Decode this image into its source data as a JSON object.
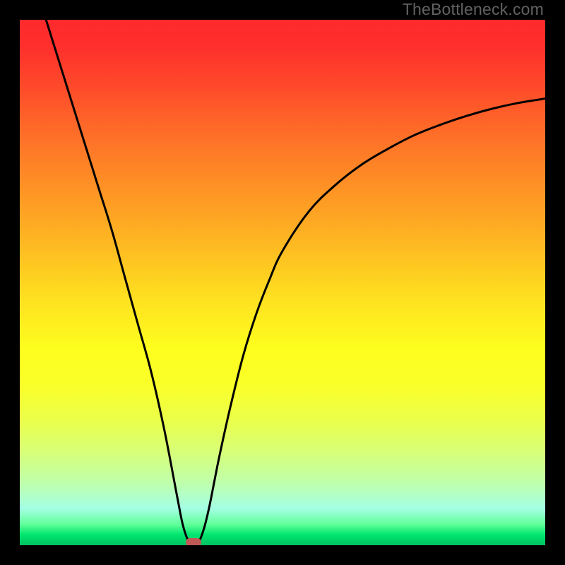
{
  "watermark": "TheBottleneck.com",
  "chart_data": {
    "type": "line",
    "title": "",
    "xlabel": "",
    "ylabel": "",
    "xlim": [
      0,
      100
    ],
    "ylim": [
      0,
      100
    ],
    "series": [
      {
        "name": "curve",
        "x": [
          5,
          7.5,
          10,
          12.5,
          15,
          17.5,
          20,
          22.5,
          25,
          27.5,
          30,
          31,
          32,
          33,
          34,
          35,
          36,
          37,
          38,
          40,
          42.5,
          45,
          47.5,
          50,
          55,
          60,
          65,
          70,
          75,
          80,
          85,
          90,
          95,
          100
        ],
        "values": [
          100,
          92,
          84,
          76,
          68,
          60,
          51,
          42,
          33,
          22,
          9,
          4,
          1,
          0,
          0.5,
          3,
          7,
          12,
          17,
          26,
          36,
          44,
          50.5,
          56,
          63.5,
          68.5,
          72.4,
          75.4,
          78,
          80,
          81.7,
          83.1,
          84.2,
          85
        ]
      }
    ],
    "marker": {
      "x": 33,
      "y": 0,
      "color": "#c05955"
    }
  }
}
